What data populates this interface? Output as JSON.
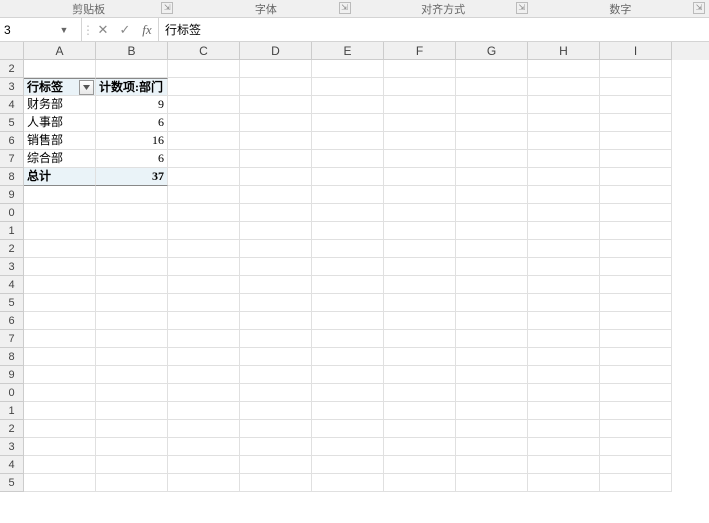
{
  "ribbon": {
    "groups": [
      "剪贴板",
      "字体",
      "对齐方式",
      "数字"
    ]
  },
  "formula_bar": {
    "cell_ref": "3",
    "dropdown_glyph": "▼",
    "sep_glyph": "⋮",
    "cancel_glyph": "✕",
    "ok_glyph": "✓",
    "fx_label": "fx",
    "formula_value": "行标签"
  },
  "columns": [
    "A",
    "B",
    "C",
    "D",
    "E",
    "F",
    "G",
    "H",
    "I"
  ],
  "visible_rows": [
    "2",
    "3",
    "4",
    "5",
    "6",
    "7",
    "8",
    "9",
    "0",
    "1",
    "2",
    "3",
    "4",
    "5",
    "6",
    "7",
    "8",
    "9",
    "0",
    "1",
    "2",
    "3",
    "4",
    "5"
  ],
  "pivot": {
    "header_row_label": "行标签",
    "header_value_label": "计数项:部门",
    "rows": [
      {
        "label": "财务部",
        "value": "9"
      },
      {
        "label": "人事部",
        "value": "6"
      },
      {
        "label": "销售部",
        "value": "16"
      },
      {
        "label": "综合部",
        "value": "6"
      }
    ],
    "total_label": "总计",
    "total_value": "37"
  }
}
